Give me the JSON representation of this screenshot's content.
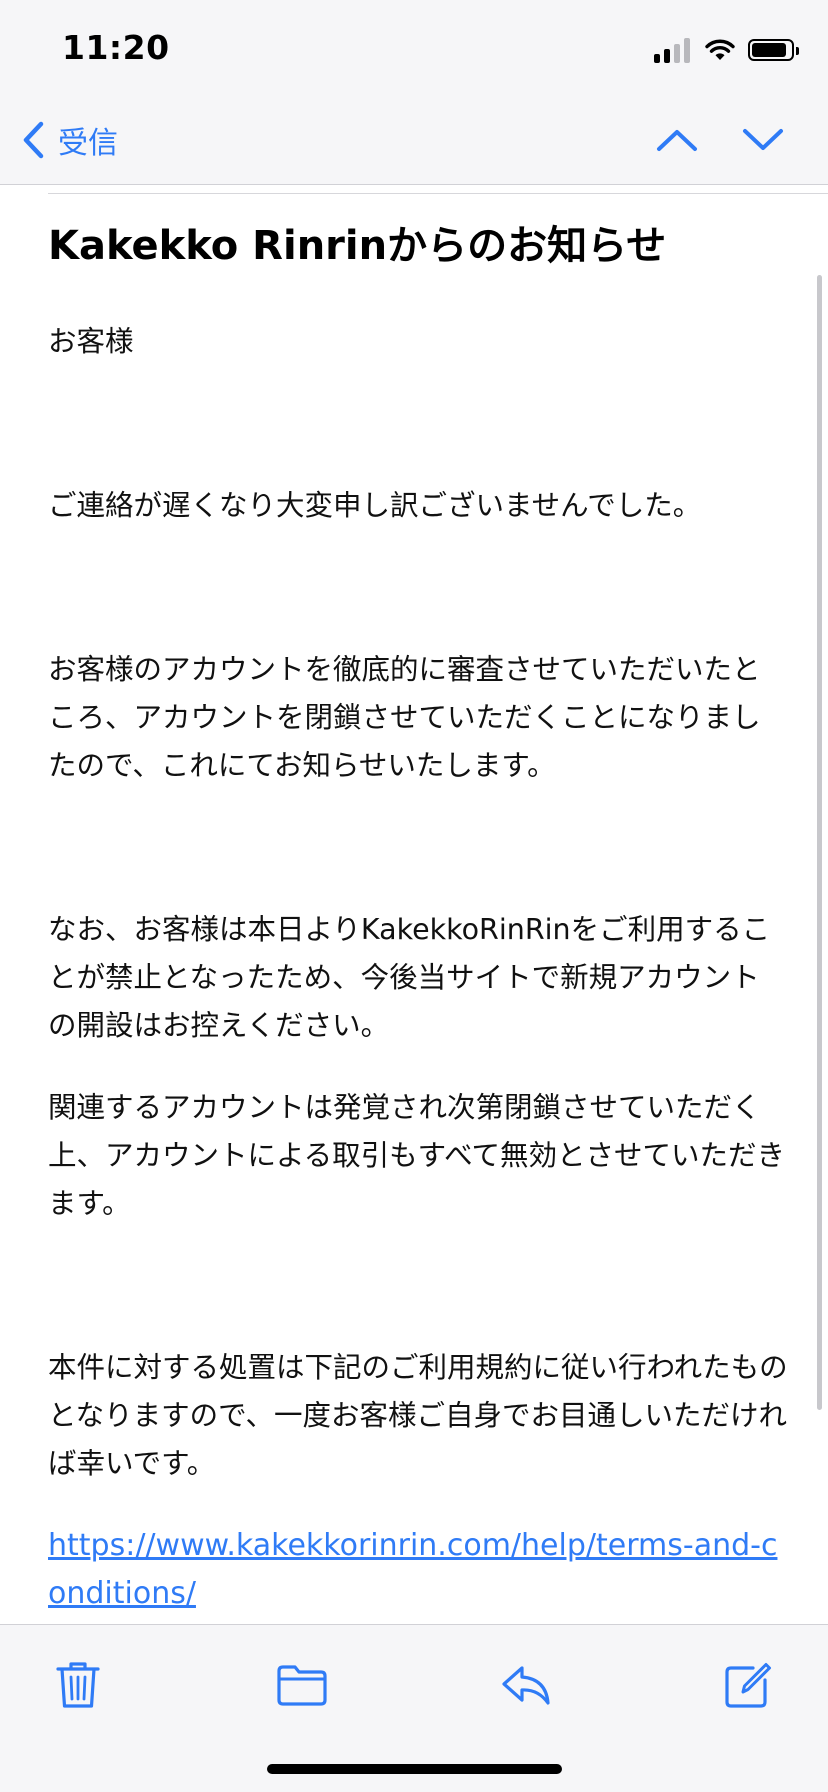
{
  "status_bar": {
    "time": "11:20"
  },
  "nav": {
    "back_label": "受信"
  },
  "email": {
    "subject": "Kakekko Rinrinからのお知らせ",
    "paragraphs": [
      "お客様",
      "ご連絡が遅くなり大変申し訳ございませんでした。",
      "お客様のアカウントを徹底的に審査させていただいたところ、アカウントを閉鎖させていただくことになりましたので、これにてお知らせいたします。",
      "なお、お客様は本日よりKakekkoRinRinをご利用することが禁止となったため、今後当サイトで新規アカウントの開設はお控えください。",
      "関連するアカウントは発覚され次第閉鎖させていただく上、アカウントによる取引もすべて無効とさせていただきます。",
      "本件に対する処置は下記のご利用規約に従い行われたものとなりますので、一度お客様ご自身でお目通しいただければ幸いです。"
    ],
    "link": "https://www.kakekkorinrin.com/help/terms-and-conditions/"
  },
  "colors": {
    "accent": "#2f7bf6",
    "bar_background": "#f6f6f8"
  },
  "icons": {
    "back": "chevron-left-icon",
    "prev": "chevron-up-icon",
    "next": "chevron-down-icon",
    "trash": "trash-icon",
    "folder": "folder-icon",
    "reply": "reply-icon",
    "compose": "compose-icon"
  }
}
